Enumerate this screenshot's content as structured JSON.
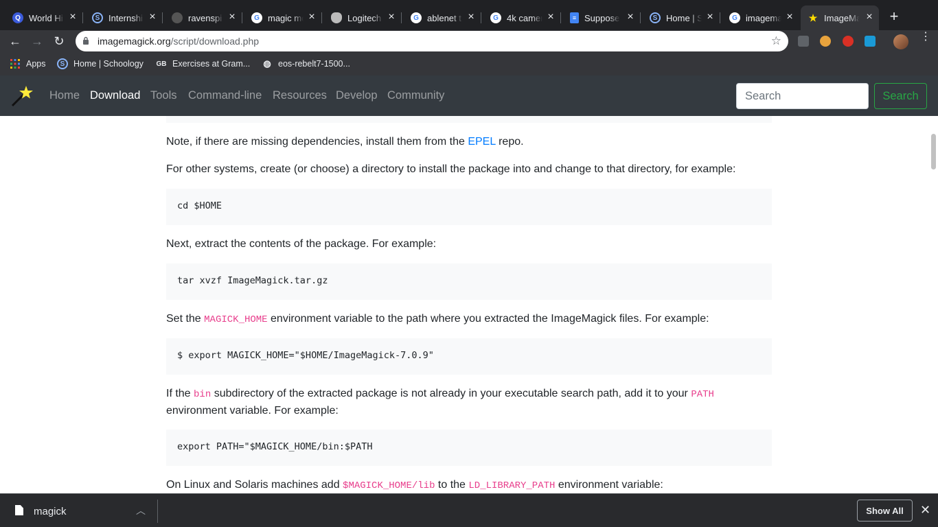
{
  "browser": {
    "tabs": [
      {
        "title": "World Hi",
        "favicon": "quora-icon",
        "color": "#4285f4"
      },
      {
        "title": "Internshi",
        "favicon": "schoology-icon",
        "color": "#1a73e8"
      },
      {
        "title": "ravenspi",
        "favicon": "github-icon",
        "color": "#333333"
      },
      {
        "title": "magic mo",
        "favicon": "google-icon",
        "color": "#ffffff"
      },
      {
        "title": "Logitech",
        "favicon": "apple-icon",
        "color": "#aaaaaa"
      },
      {
        "title": "ablenet t",
        "favicon": "google-icon",
        "color": "#ffffff"
      },
      {
        "title": "4k camer",
        "favicon": "google-icon",
        "color": "#ffffff"
      },
      {
        "title": "Suppose",
        "favicon": "docs-icon",
        "color": "#4285f4"
      },
      {
        "title": "Home | S",
        "favicon": "schoology-icon",
        "color": "#1a73e8"
      },
      {
        "title": "imagema",
        "favicon": "google-icon",
        "color": "#ffffff"
      },
      {
        "title": "ImageMa",
        "favicon": "imagemagick-icon",
        "color": "#ffdd00",
        "active": true
      }
    ],
    "url_domain": "imagemagick.org",
    "url_path": "/script/download.php",
    "bookmarks": [
      {
        "label": "Apps",
        "icon": "apps-grid-icon"
      },
      {
        "label": "Home | Schoology",
        "icon": "schoology-icon"
      },
      {
        "label": "Exercises at Gram...",
        "icon": "gb-icon"
      },
      {
        "label": "eos-rebelt7-1500...",
        "icon": "globe-icon"
      }
    ]
  },
  "site": {
    "nav": [
      "Home",
      "Download",
      "Tools",
      "Command-line",
      "Resources",
      "Develop",
      "Community"
    ],
    "active_nav": "Download",
    "search_placeholder": "Search",
    "search_button": "Search"
  },
  "content": {
    "p1": {
      "before": "Note, if there are missing dependencies, install them from the ",
      "link": "EPEL",
      "after": " repo."
    },
    "p2": "For other systems, create (or choose) a directory to install the package into and change to that directory, for example:",
    "code1": "cd $HOME",
    "p3": "Next, extract the contents of the package. For example:",
    "code2": "tar xvzf ImageMagick.tar.gz",
    "p4": {
      "before": "Set the ",
      "code": "MAGICK_HOME",
      "after": " environment variable to the path where you extracted the ImageMagick files. For example:"
    },
    "code3": "$ export MAGICK_HOME=\"$HOME/ImageMagick-7.0.9\"",
    "p5": {
      "before": "If the ",
      "code1": "bin",
      "middle": " subdirectory of the extracted package is not already in your executable search path, add it to your ",
      "code2": "PATH",
      "after": " environment variable. For example:"
    },
    "code4": "export PATH=\"$MAGICK_HOME/bin:$PATH",
    "p6": {
      "before": "On Linux and Solaris machines add ",
      "code1": "$MAGICK_HOME/lib",
      "middle": " to the ",
      "code2": "LD_LIBRARY_PATH",
      "after": " environment variable:"
    }
  },
  "downloads": {
    "filename": "magick",
    "show_all": "Show All"
  }
}
